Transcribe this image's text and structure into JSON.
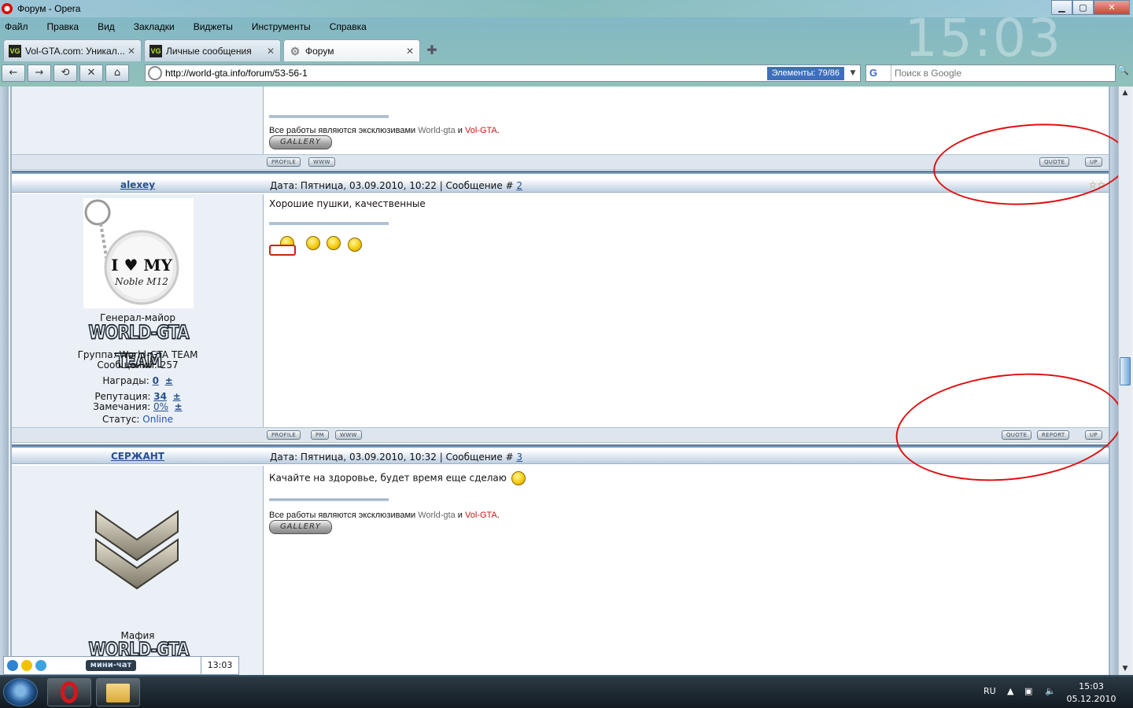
{
  "window": {
    "title": "Форум - Opera",
    "min": "▁",
    "max": "▢",
    "close": "✕"
  },
  "menu": [
    "Файл",
    "Правка",
    "Вид",
    "Закладки",
    "Виджеты",
    "Инструменты",
    "Справка"
  ],
  "desktop_clock_watermark": "15:03",
  "tabs": [
    {
      "label": "Vol-GTA.com: Уникал...",
      "favicon": "vol-gta-icon",
      "active": false
    },
    {
      "label": "Личные сообщения",
      "favicon": "vol-gta-icon",
      "active": false
    },
    {
      "label": "Форум",
      "favicon": "gear-icon",
      "active": true
    }
  ],
  "tab_close_glyph": "✕",
  "tab_new_glyph": "✚",
  "favicon_text": "VG",
  "nav": {
    "back": "←",
    "forward": "→",
    "rewind": "⟲",
    "stop": "✕",
    "home": "⌂",
    "url": "http://world-gta.info/forum/53-56-1",
    "elements_badge": "Элементы:  79/86",
    "dropdown": "▼"
  },
  "search": {
    "engine": "G",
    "placeholder": "Поиск в Google",
    "button": "🔍"
  },
  "post0": {
    "sig_text": "Все работы являются эксклюзивами ",
    "sig_a": "World-gta",
    "sig_and": " и ",
    "sig_b": "Vol-GTA",
    "sig_dot": ".",
    "gallery": "GALLERY",
    "btn_profile": "PROFILE",
    "btn_www": "WWW",
    "btn_quote": "QUOTE",
    "btn_up": "UP"
  },
  "post1": {
    "nick": "alexey",
    "date": "Дата: Пятница, 03.09.2010, 10:22 | Сообщение # ",
    "num": "2",
    "text": "Хорошие пушки, качественные",
    "avatar_line1": "I ♥ MY",
    "avatar_line2": "Noble M12",
    "rank": "Генерал-майор",
    "team_logo": "WORLD-GTA TEAM",
    "group": "Группа: World-GTA TEAM",
    "messages": "Сообщений: 257",
    "awards_label": "Награды: ",
    "awards_value": "0",
    "plus": "±",
    "rep_label": "Репутация: ",
    "rep_value": "34",
    "warn_label": "Замечания: ",
    "warn_value": "0%",
    "status_label": "Статус: ",
    "status_value": "Online",
    "btn_profile": "PROFILE",
    "btn_pm": "PM",
    "btn_www": "WWW",
    "btn_quote": "QUOTE",
    "btn_report": "REPORT",
    "btn_up": "UP"
  },
  "post2": {
    "nick": "СЕРЖАНТ",
    "date": "Дата: Пятница, 03.09.2010, 10:32 | Сообщение # ",
    "num": "3",
    "text": "Качайте на здоровье, будет время еще сделаю",
    "rank": "Мафия",
    "team_logo": "WORLD-GTA TEAM",
    "sig_text": "Все работы являются эксклюзивами ",
    "sig_a": "World-gta",
    "sig_and": " и ",
    "sig_b": "Vol-GTA",
    "sig_dot": ".",
    "gallery": "GALLERY"
  },
  "minichat": {
    "label": "мини-чат",
    "time": "13:03"
  },
  "taskbar": {
    "lang": "RU",
    "time": "15:03",
    "date": "05.12.2010"
  },
  "colors": {
    "annotation": "#e01010",
    "link": "#28508c",
    "accent_red": "#c81818"
  }
}
